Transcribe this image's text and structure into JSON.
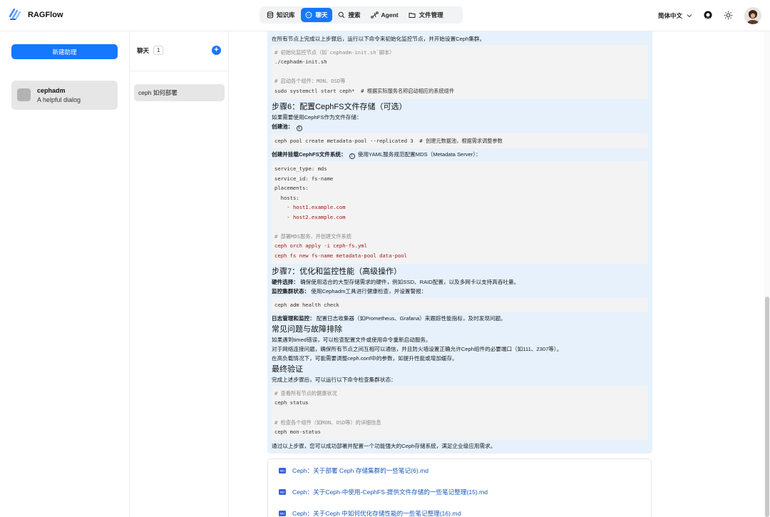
{
  "app": {
    "name": "RAGFlow"
  },
  "nav": {
    "items": [
      {
        "label": "知识库",
        "icon": "database-icon"
      },
      {
        "label": "聊天",
        "icon": "chat-bubble-icon",
        "active": true
      },
      {
        "label": "搜索",
        "icon": "search-icon"
      },
      {
        "label": "Agent",
        "icon": "agent-icon"
      },
      {
        "label": "文件管理",
        "icon": "folder-icon"
      }
    ]
  },
  "header": {
    "language": "简体中文",
    "github_icon": "github-icon",
    "theme_icon": "sun-icon"
  },
  "sidebar": {
    "new_button": "新建助理",
    "assistant": {
      "name": "cephadm",
      "description": "A helpful dialog"
    }
  },
  "chats": {
    "title": "聊天",
    "count": "1",
    "items": [
      {
        "label": "ceph 如何部署"
      }
    ]
  },
  "message": {
    "intro": "在所有节点上完成以上步骤后，运行以下命令来初始化监控节点，并开始设置Ceph集群。",
    "code1": [
      "# 初始化监控节点（如`cephadm-init.sh`脚本）",
      "./cephadm-init.sh",
      "",
      "# 启动各个组件：MON、OSD等",
      "sudo systemctl start ceph*  # 根据实际服务名称启动相应的系统组件"
    ],
    "step6_title": "步骤6：配置CephFS文件存储（可选）",
    "step6_desc": "如果需要使用CephFS作为文件存储：",
    "create_pool_label": "创建池：",
    "code2": "ceph pool create metadata-pool --replicated 3  # 创建元数据池，根据需求调整参数",
    "mount_label": "创建并挂载CephFS文件系统：",
    "mount_desc": "使用YAML服务规范配置MDS（Metadata Server）：",
    "code3": [
      "service_type: mds",
      "service_id: fs-name",
      "placements:",
      "  hosts:",
      "    - host1.example.com",
      "    - host2.example.com",
      "",
      "# 部署MDS服务，并创建文件系统",
      "ceph orch apply -i ceph-fs.yml",
      "ceph fs new fs-name metadata-pool data-pool"
    ],
    "step7_title": "步骤7：优化和监控性能（高级操作）",
    "hw_label": "硬件选择：",
    "hw_text": "确保使用适合的大型存储需求的硬件，例如SSD、RAID配置，以及多网卡以支持高吞吐量。",
    "monitor_label": "监控集群状态：",
    "monitor_text": "使用Cephadm工具进行健康检查，并设置警报：",
    "code4": "ceph adm health check",
    "log_label": "日志管理和监控：",
    "log_text": "配置日志收集器（如Prometheus、Grafana）来跟踪性能指标，及时发现问题。",
    "faq_title": "常见问题与故障排除",
    "faq1": "如果遇到timed错误，可以检查配置文件或使用命令重新启动服务。",
    "faq2": "对于网络连接问题，确保所有节点之间互相可以通信，并且防火墙设置正确允许Ceph组件的必要端口（如111、2307等）。",
    "faq3": "在高负载情况下，可能需要调整ceph.conf中的参数，如提升性能或增加缓存。",
    "final_title": "最终验证",
    "final_desc": "完成上述步骤后，可以运行以下命令检查集群状态：",
    "code5": [
      "# 查看所有节点的健康状况",
      "ceph status",
      "",
      "# 检查各个组件（如MON、OSD等）的详细信息",
      "ceph mon-status"
    ],
    "conclusion": "通过以上步骤，您可以成功部署并配置一个功能强大的Ceph存储系统，满足企业级应用需求。"
  },
  "references": [
    {
      "label": "Ceph：关于部署 Ceph 存储集群的一些笔记(6).md"
    },
    {
      "label": "Ceph：关于Ceph-中使用-CephFS-提供文件存储的一些笔记整理(15).md"
    },
    {
      "label": "Ceph：关于Ceph 中如何优化存储性能的一些笔记整理(16).md"
    }
  ],
  "colors": {
    "accent": "#1677ff",
    "bubble": "#e6f1fc",
    "code_bg": "#f3f3f3"
  }
}
